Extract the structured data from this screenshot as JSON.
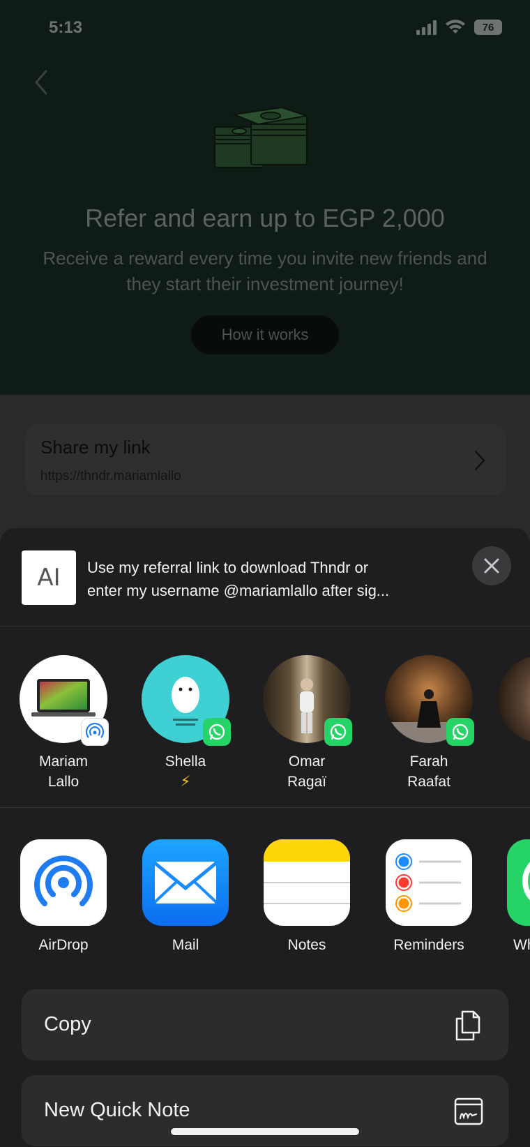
{
  "status_bar": {
    "time": "5:13",
    "battery": "76"
  },
  "hero": {
    "title": "Refer and earn up to EGP 2,000",
    "subtitle": "Receive a reward every time you invite new friends and they start their investment journey!",
    "how_button": "How it works"
  },
  "share_link": {
    "title": "Share my link",
    "url": "https://thndr.mariamlallo"
  },
  "share_sheet": {
    "preview_line1": "Use my referral link to download Thndr or",
    "preview_line2": "enter my username @mariamlallo after sig...",
    "people": [
      {
        "line1": "Mariam",
        "line2": "Lallo",
        "badge": "airdrop-badge-icon"
      },
      {
        "line1": "Shella",
        "line2": "⚡",
        "badge": "whatsapp-badge-icon"
      },
      {
        "line1": "Omar",
        "line2": "Ragaï",
        "badge": "whatsapp-badge-icon"
      },
      {
        "line1": "Farah",
        "line2": "Raafat",
        "badge": "whatsapp-badge-icon"
      }
    ],
    "apps": [
      {
        "label": "AirDrop",
        "icon": "airdrop-icon"
      },
      {
        "label": "Mail",
        "icon": "mail-icon"
      },
      {
        "label": "Notes",
        "icon": "notes-icon"
      },
      {
        "label": "Reminders",
        "icon": "reminders-icon"
      },
      {
        "label": "Wh",
        "icon": "whatsapp-icon"
      }
    ],
    "actions": [
      {
        "label": "Copy",
        "icon": "copy-icon"
      },
      {
        "label": "New Quick Note",
        "icon": "quick-note-icon"
      }
    ]
  },
  "colors": {
    "whatsapp": "#25d366",
    "mail_blue": "#1a8cff",
    "airdrop_blue": "#1f7cf0",
    "notes_yellow": "#ffd60a",
    "sheet_bg": "#1e1e20"
  }
}
